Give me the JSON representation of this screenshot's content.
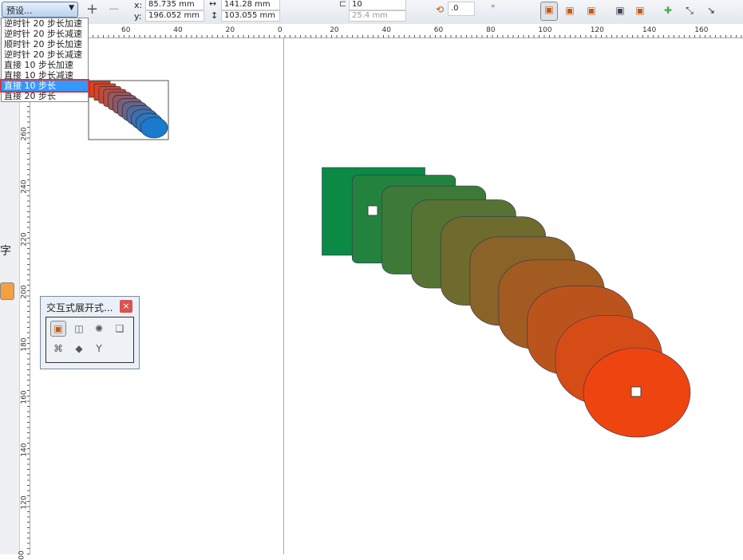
{
  "toolbar": {
    "preset_label": "预设...",
    "x_label": "x:",
    "x_value": "85.735 mm",
    "y_label": "y:",
    "y_value": "196.052 mm",
    "width_value": "141.28 mm",
    "height_value": "103.055 mm",
    "steps_value": "10",
    "spacing_value": "25.4 mm",
    "angle_value": ".0",
    "degree_symbol": "°"
  },
  "preset_options": [
    "逆时针 20 步长加速",
    "逆时针 20 步长减速",
    "顺时针 20 步长加速",
    "逆时针 20 步长减速",
    "直接 10 步长加速",
    "直接 10 步长减速",
    "直接 10 步长",
    "直接 20 步长"
  ],
  "selected_option": "直接 10 步长",
  "ruler_top": [
    "60",
    "40",
    "20",
    "0",
    "20",
    "40",
    "60",
    "80",
    "100",
    "120",
    "140",
    "160"
  ],
  "ruler_left": [
    "260",
    "240",
    "220",
    "200",
    "180",
    "160",
    "140",
    "120",
    "00"
  ],
  "toolbox": {
    "text_tool": "字"
  },
  "docker": {
    "title": "交互式展开式...",
    "close": "×"
  },
  "blend": {
    "start_color": "#0a8a44",
    "end_color": "#ee4410",
    "steps": 10
  },
  "thumbnail": {
    "start_color": "#e8401a",
    "end_color": "#1a7acc"
  }
}
